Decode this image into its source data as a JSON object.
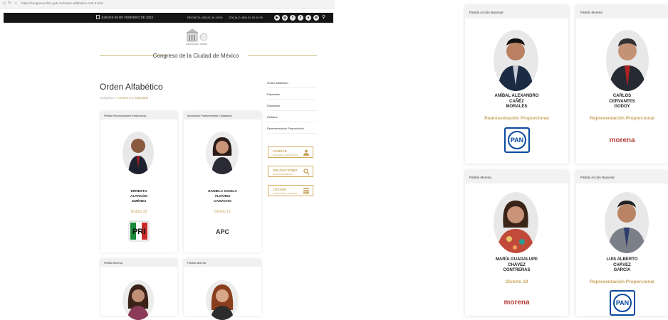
{
  "browser": {
    "url": "https://congresocdmx.gob.mx/orden-alfabetico-106-2.html"
  },
  "topbar": {
    "date": "JUEVES 09 DE FEBRERO DE 2023",
    "phone1": "RECINTO: (55) 51 30 19 00",
    "phone2": "ZÓCALO: (55) 51 30 19 00",
    "social_icons": [
      "youtube-icon",
      "instagram-icon",
      "facebook-icon",
      "twitter-icon",
      "flickr-icon",
      "spotify-icon",
      "search-icon"
    ]
  },
  "header": {
    "site_name": "Congreso de la Ciudad de México"
  },
  "page": {
    "title": "Orden Alfabético",
    "breadcrumb_home": "Congreso",
    "breadcrumb_current": "Conoce a tu Diputado"
  },
  "left_cards": [
    {
      "party": "Partido Revolucionario Institucional",
      "name": [
        "ERNESTO",
        "ALARCÓN",
        "JIMÉNEZ"
      ],
      "district": "Distrito 33",
      "logo": "PRI"
    },
    {
      "party": "Asociación Parlamentaria Ciudadana",
      "name": [
        "DANIELA GICELA",
        "ÁLVAREZ",
        "CAMACHO"
      ],
      "district": "Distrito 16",
      "logo": "APC"
    },
    {
      "party": "Partido Morena"
    },
    {
      "party": "Partido Morena"
    }
  ],
  "menu": [
    "Orden Alfabético",
    "Diputadas",
    "Diputados",
    "Distritos",
    "Representación Proporcional"
  ],
  "buttons": [
    {
      "title": "CONOCE",
      "subtitle": "DIPUTADAS Y DIPUTADOS",
      "icon": "person-icon"
    },
    {
      "title": "OBLIGACIONES",
      "subtitle": "DE TRANSPARENCIA",
      "icon": "search-icon"
    },
    {
      "title": "LISTADO",
      "subtitle": "COMISIONES Y COMITÉS",
      "icon": "list-icon"
    }
  ],
  "right_cards": [
    {
      "party": "Partido Acción Nacional",
      "name": [
        "ANÍBAL ALEXANDRO",
        "CAÑÉZ",
        "MORALES"
      ],
      "district": "Representación Proporcional",
      "logo": "PAN"
    },
    {
      "party": "Partido Morena",
      "name": [
        "CARLOS",
        "CERVANTES",
        "GODOY"
      ],
      "district": "Representación Proporcional",
      "logo": "morena"
    },
    {
      "party": "Partido Morena",
      "name": [
        "MARÍA GUADALUPE",
        "CHÁVEZ",
        "CONTRERAS"
      ],
      "district": "Distrito 19",
      "logo": "morena"
    },
    {
      "party": "Partido Acción Nacional",
      "name": [
        "LUIS ALBERTO",
        "CHÁVEZ",
        "GARCÍA"
      ],
      "district": "Representación Proporcional",
      "logo": "PAN"
    }
  ],
  "colors": {
    "accent": "#c9a25c",
    "topbar": "#151515",
    "pan_blue": "#0a4aa0",
    "morena_red": "#b5413a"
  }
}
